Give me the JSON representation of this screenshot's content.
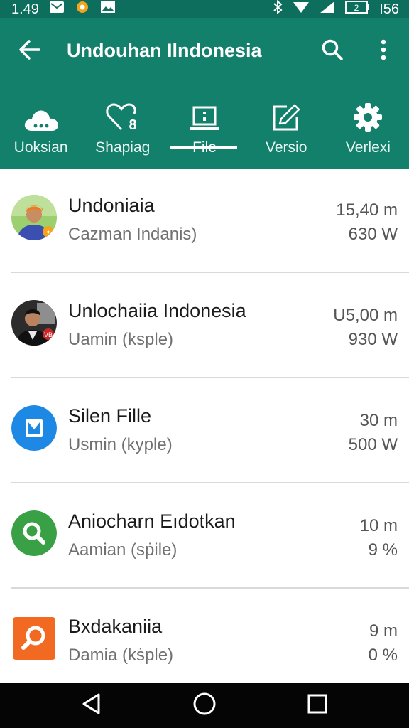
{
  "status_bar": {
    "time": "1.49",
    "right_text": "I56",
    "icons": [
      "mail-icon",
      "flower-icon",
      "image-icon",
      "bluetooth-icon",
      "wifi-icon",
      "signal-icon",
      "battery-icon"
    ]
  },
  "toolbar": {
    "title": "Undouhan Ilndonesia"
  },
  "tabs": [
    {
      "label": "Uoksian",
      "icon": "cloud-icon"
    },
    {
      "label": "Shapiag",
      "icon": "heart-icon"
    },
    {
      "label": "File",
      "icon": "laptop-icon"
    },
    {
      "label": "Versio",
      "icon": "edit-icon"
    },
    {
      "label": "Verlexi",
      "icon": "gear-icon"
    }
  ],
  "active_tab": "File",
  "items": [
    {
      "name": "Undoniaia",
      "subtitle": "Cazman Indanis)",
      "value1": "15,40 m",
      "value2": "630 W",
      "avatar": "person-photo"
    },
    {
      "name": "Unlochaiia Indonesia",
      "subtitle": "Uamin (ksple)",
      "value1": "U5,00 m",
      "value2": "930 W",
      "avatar": "person-photo"
    },
    {
      "name": "Silen Fille",
      "subtitle": "Usmin (kyple)",
      "value1": "30 m",
      "value2": "500 W",
      "avatar": "blue-app-icon"
    },
    {
      "name": "Aniocharn Eıdotkan",
      "subtitle": "Aamian (sṗile)",
      "value1": "10 m",
      "value2": "9 %",
      "avatar": "green-search-icon"
    },
    {
      "name": "Bxdakaniia",
      "subtitle": "Damia (kṡple)",
      "value1": "9 m",
      "value2": "0 %",
      "avatar": "orange-search-icon"
    }
  ],
  "colors": {
    "app_bar": "#13806c",
    "status_bar": "#0e6e5e",
    "nav_bar": "#050505"
  }
}
